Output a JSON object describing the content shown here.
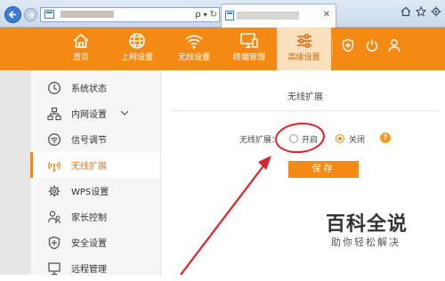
{
  "browser": {
    "search_glyph": "ρ",
    "refresh_glyph": "↻",
    "go_glyph": "▾",
    "close_glyph": "✕"
  },
  "header": {
    "nav": [
      {
        "label": "首页",
        "icon": "home-icon"
      },
      {
        "label": "上网设置",
        "icon": "globe-icon"
      },
      {
        "label": "无线设置",
        "icon": "wifi-icon"
      },
      {
        "label": "终端管理",
        "icon": "monitor-icon"
      },
      {
        "label": "高级设置",
        "icon": "sliders-icon"
      }
    ],
    "active_index": 4,
    "utility_icons": [
      "shield-plus-icon",
      "power-icon",
      "user-icon"
    ]
  },
  "sidebar": {
    "items": [
      {
        "label": "系统状态",
        "icon": "clock-icon"
      },
      {
        "label": "内网设置",
        "icon": "network-icon"
      },
      {
        "label": "信号调节",
        "icon": "signal-icon"
      },
      {
        "label": "无线扩展",
        "icon": "wireless-extend-icon"
      },
      {
        "label": "WPS设置",
        "icon": "gear-icon"
      },
      {
        "label": "家长控制",
        "icon": "parent-icon"
      },
      {
        "label": "安全设置",
        "icon": "shield-icon"
      },
      {
        "label": "远程管理",
        "icon": "remote-icon"
      }
    ],
    "active_index": 3
  },
  "main": {
    "title": "无线扩展",
    "field_label": "无线扩展：",
    "options": [
      {
        "label": "开启",
        "selected": false
      },
      {
        "label": "关闭",
        "selected": true
      }
    ],
    "help_label": "?",
    "save_label": "保存"
  },
  "colors": {
    "accent": "#f58a12",
    "annotation": "#d9222a"
  },
  "watermark": {
    "title": "百科全说",
    "subtitle": "助你轻松解决"
  }
}
